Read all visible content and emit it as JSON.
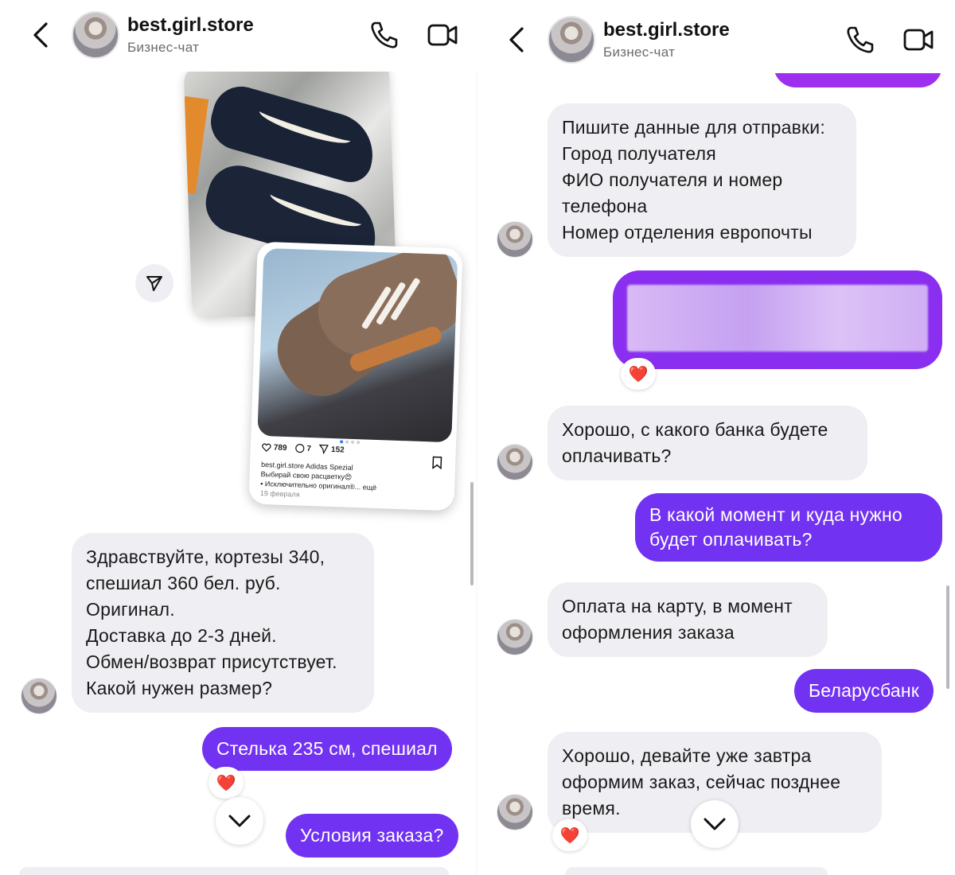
{
  "colors": {
    "outgoing_bubble": "#7232f2",
    "incoming_bubble": "#efeff3",
    "heart": "#e0142e",
    "secondary_text": "#6b6b6b"
  },
  "left_panel": {
    "header": {
      "name": "best.girl.store",
      "subtitle": "Бизнес-чат",
      "icons": [
        "back-arrow-icon",
        "phone-icon",
        "video-camera-icon"
      ]
    },
    "shared_post": {
      "likes": "789",
      "comments": "7",
      "shares": "152",
      "caption_lines": [
        "best.girl.store Adidas Spezial",
        "Выбирай свою расцветку😍",
        "▪ Исключительно оригинал®... ещё"
      ],
      "date": "19 февраля"
    },
    "messages": [
      {
        "from": "store",
        "lines": [
          "Здравствуйте, кортезы 340,",
          "спешиал 360  бел. руб.",
          "Оригинал.",
          "Доставка до 2-3 дней.",
          "Обмен/возврат присутствует.",
          "Какой нужен размер?"
        ]
      },
      {
        "from": "me",
        "text": "Стелька 235 см, спешиал",
        "reaction": "❤️"
      },
      {
        "from": "me",
        "text": "Условия заказа?"
      }
    ]
  },
  "right_panel": {
    "header": {
      "name": "best.girl.store",
      "subtitle": "Бизнес-чат"
    },
    "messages": [
      {
        "from": "store",
        "lines": [
          "Пишите данные для отправки:",
          "Город получателя",
          "ФИО получателя и номер",
          "телефона",
          "Номер отделения европочты"
        ]
      },
      {
        "from": "me",
        "text": "",
        "blurred": true,
        "reaction": "❤️"
      },
      {
        "from": "store",
        "lines": [
          "Хорошо, с какого банка будете",
          "оплачивать?"
        ]
      },
      {
        "from": "me",
        "lines": [
          "В какой момент и куда нужно",
          "будет оплачивать?"
        ]
      },
      {
        "from": "store",
        "lines": [
          "Оплата на карту, в момент",
          "оформления заказа"
        ]
      },
      {
        "from": "me",
        "text": "Беларусбанк"
      },
      {
        "from": "store",
        "lines": [
          "Хорошо, девайте уже завтра",
          "оформим заказ, сейчас позднее",
          "время."
        ],
        "reaction": "❤️"
      }
    ]
  }
}
